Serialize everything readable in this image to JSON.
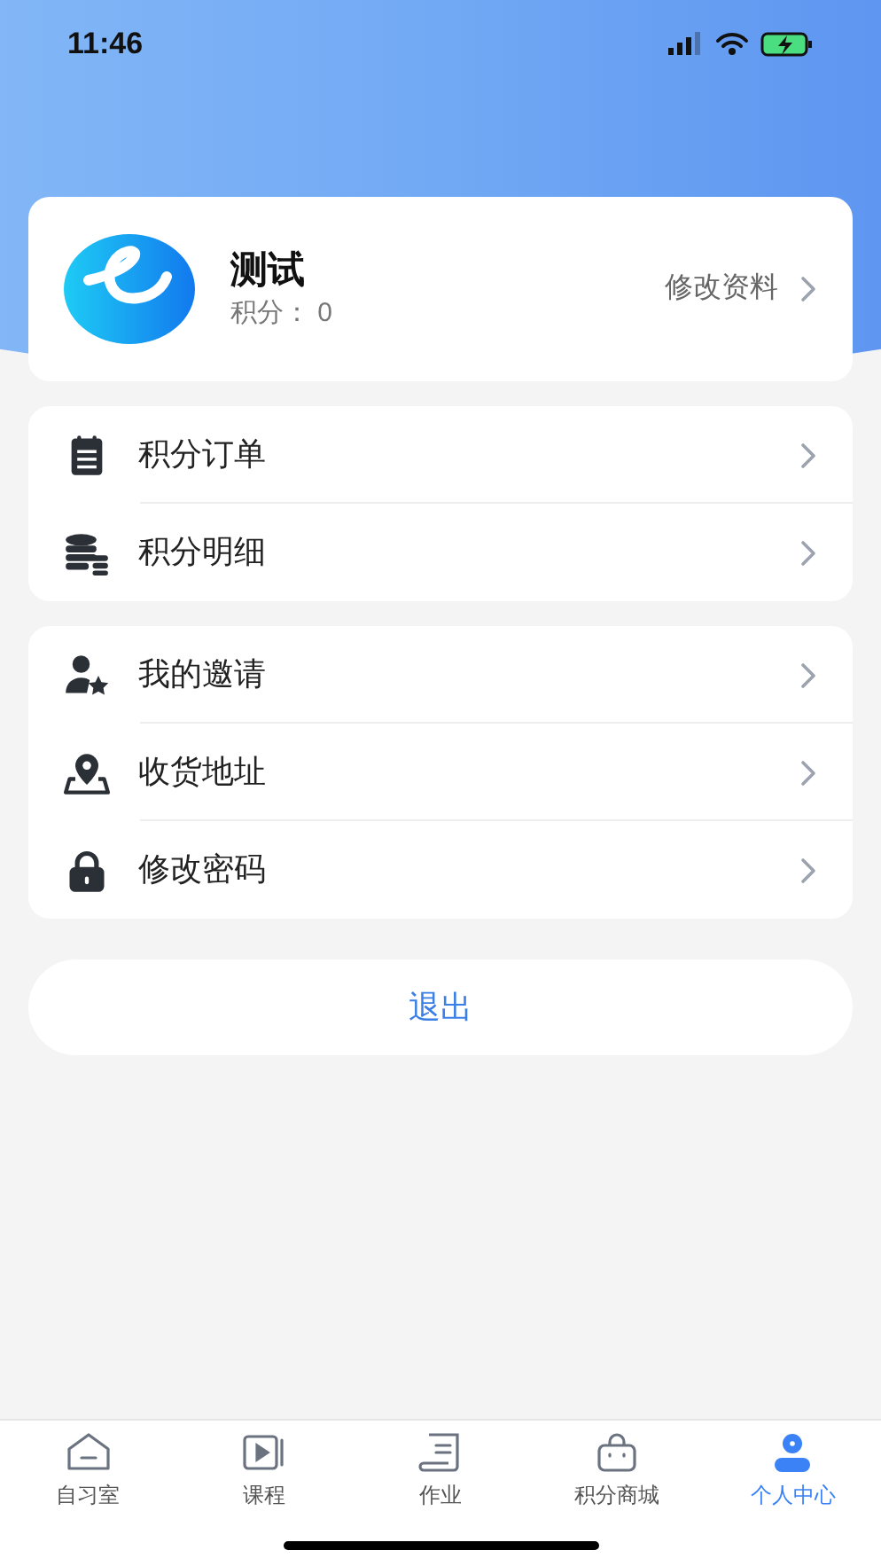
{
  "status_bar": {
    "time": "11:46"
  },
  "profile": {
    "name": "测试",
    "points_label": "积分：",
    "points": "0",
    "edit_link": "修改资料"
  },
  "menu_groups": [
    {
      "items": [
        {
          "kind": "orders",
          "label": "积分订单"
        },
        {
          "kind": "points",
          "label": "积分明细"
        }
      ]
    },
    {
      "items": [
        {
          "kind": "invite",
          "label": "我的邀请"
        },
        {
          "kind": "address",
          "label": "收货地址"
        },
        {
          "kind": "password",
          "label": "修改密码"
        }
      ]
    }
  ],
  "logout_button": "退出",
  "tab_bar": [
    {
      "kind": "study",
      "label": "自习室",
      "selected": false
    },
    {
      "kind": "course",
      "label": "课程",
      "selected": false
    },
    {
      "kind": "homework",
      "label": "作业",
      "selected": false
    },
    {
      "kind": "shop",
      "label": "积分商城",
      "selected": false
    },
    {
      "kind": "profile",
      "label": "个人中心",
      "selected": true
    }
  ]
}
